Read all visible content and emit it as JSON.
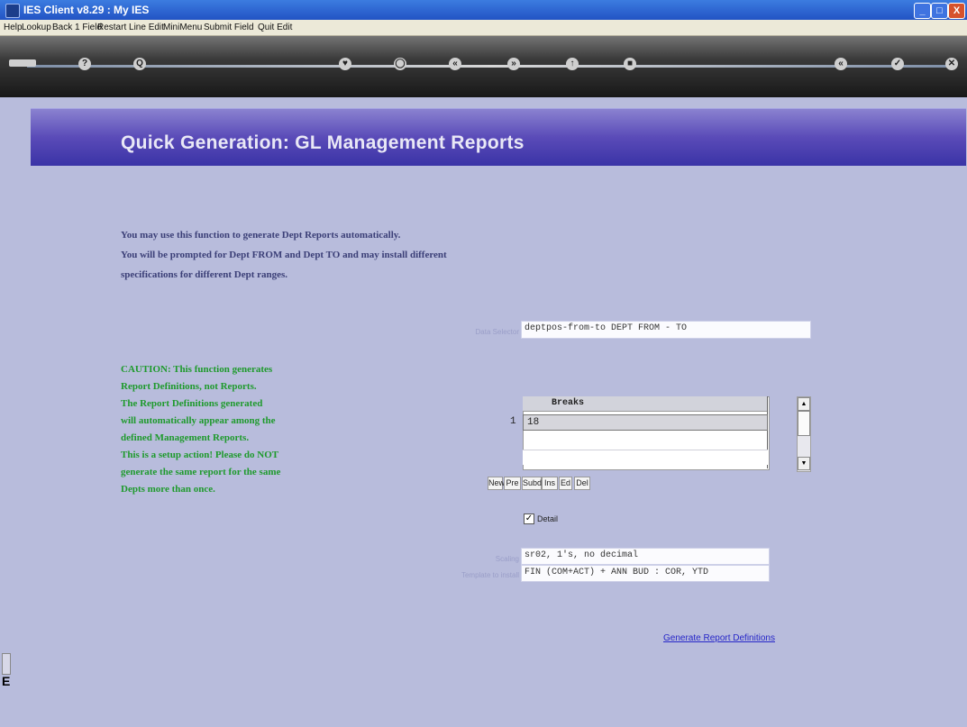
{
  "window": {
    "title": "IES Client v8.29 : My IES",
    "min_label": "_",
    "max_label": "□",
    "close_label": "X"
  },
  "menu": [
    "Help",
    "Lookup",
    "Back 1 Field",
    "Restart Line Edit",
    "MiniMenu",
    "Submit Field",
    "Quit Edit"
  ],
  "toolbar": {
    "icons": [
      "arrow-icon",
      "help-icon",
      "search-icon",
      "heart-icon",
      "circle-icon",
      "rewind-icon",
      "forward-icon",
      "up-icon",
      "stop-icon",
      "hold-icon",
      "check-icon",
      "close-icon"
    ],
    "glyphs": [
      "?",
      "Q",
      "♥",
      "◯",
      "«",
      "»",
      "↑",
      "■",
      "«",
      "✓",
      "✕"
    ]
  },
  "page": {
    "title": "Quick Generation: GL Management Reports",
    "intro_lines": [
      "You may use this function to generate Dept Reports automatically.",
      "You will be prompted for Dept FROM and  Dept TO and may install different",
      "specifications for different Dept   ranges."
    ],
    "caution_lines": [
      "CAUTION: This function generates",
      "Report Definitions, not Reports.",
      "The Report Definitions generated",
      "will automatically appear among the",
      "defined Management Reports.",
      "This is a setup action! Please do NOT",
      "generate the same report for the same",
      "Depts more than once."
    ]
  },
  "form": {
    "data_selector_label": "Data Selector",
    "data_selector_value": "deptpos-from-to DEPT FROM - TO",
    "breaks_header": "Breaks",
    "breaks_rows": [
      {
        "num": "1",
        "value": "18"
      }
    ],
    "grid_buttons": [
      "New",
      "Pre",
      "Subd",
      "Ins",
      "Ed",
      "Del"
    ],
    "detail_label": "Detail",
    "detail_checked": true,
    "scaling_label": "Scaling",
    "scaling_value": "sr02, 1's, no decimal",
    "template_label": "Template to install",
    "template_value": "FIN (COM+ACT) + ANN BUD : COR, YTD",
    "generate_link": "Generate Report Definitions"
  },
  "left_panel": {
    "letter": "E"
  }
}
